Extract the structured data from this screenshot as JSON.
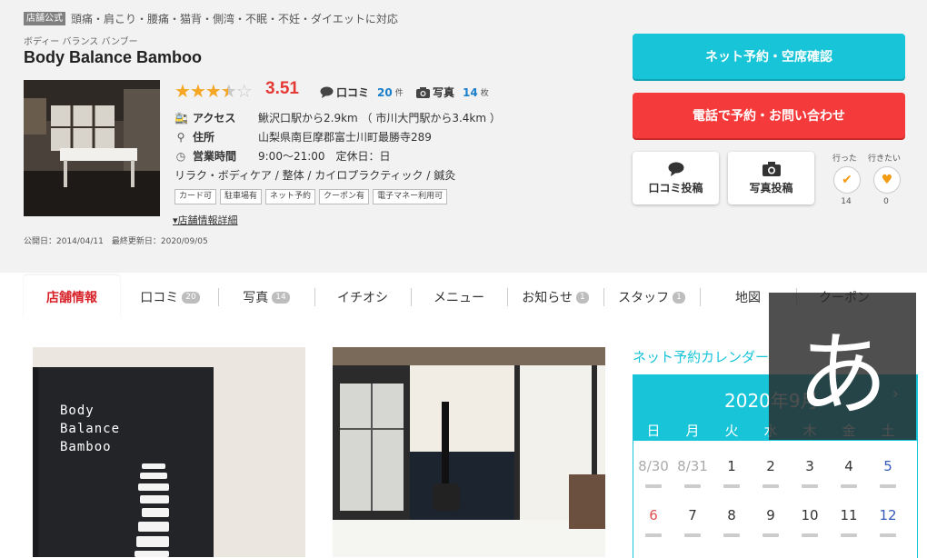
{
  "header": {
    "official_badge": "店舗公式",
    "tagline": "頭痛・肩こり・腰痛・猫背・側湾・不眠・不妊・ダイエットに対応",
    "name_kana": "ボディー バランス バンブー",
    "name": "Body Balance Bamboo",
    "rating": {
      "stars": 3.5,
      "value": "3.51"
    },
    "reviews": {
      "label": "口コミ",
      "count": "20",
      "unit": "件",
      "icon": "speech-bubble-icon"
    },
    "photos": {
      "label": "写真",
      "count": "14",
      "unit": "枚",
      "icon": "camera-icon"
    },
    "access": {
      "label": "アクセス",
      "value": "鰍沢口駅から2.9km （ 市川大門駅から3.4km ）",
      "icon": "train-icon"
    },
    "address": {
      "label": "住所",
      "value": "山梨県南巨摩郡富士川町最勝寺289",
      "icon": "pin-icon"
    },
    "hours": {
      "label": "営業時間",
      "value": "9:00～21:00　定休日：日",
      "icon": "clock-icon"
    },
    "categories": "リラク・ボディケア / 整体 / カイロプラクティック / 鍼灸",
    "features": [
      "カード可",
      "駐車場有",
      "ネット予約",
      "クーポン有",
      "電子マネー利用可"
    ],
    "details_link": "▾店舗情報詳細",
    "dates": "公開日：2014/04/11　最終更新日：2020/09/05"
  },
  "actions": {
    "net_reserve": "ネット予約・空席確認",
    "phone_reserve": "電話で予約・お問い合わせ",
    "post_review": "口コミ投稿",
    "post_photo": "写真投稿",
    "went": {
      "label": "行った",
      "count": "14"
    },
    "want": {
      "label": "行きたい",
      "count": "0"
    }
  },
  "tabs": [
    {
      "label": "店舗情報",
      "count": ""
    },
    {
      "label": "口コミ",
      "count": "20"
    },
    {
      "label": "写真",
      "count": "14"
    },
    {
      "label": "イチオシ",
      "count": ""
    },
    {
      "label": "メニュー",
      "count": ""
    },
    {
      "label": "お知らせ",
      "count": "1"
    },
    {
      "label": "スタッフ",
      "count": "1"
    },
    {
      "label": "地図",
      "count": ""
    },
    {
      "label": "クーポン",
      "count": ""
    }
  ],
  "card_text": [
    "Body",
    "Balance",
    "Bamboo"
  ],
  "calendar": {
    "title": "ネット予約カレンダー",
    "month": "2020年9月",
    "next": "›",
    "weekdays": [
      "日",
      "月",
      "火",
      "水",
      "木",
      "金",
      "土"
    ],
    "rows": [
      [
        "8/30",
        "8/31",
        "1",
        "2",
        "3",
        "4",
        "5"
      ],
      [
        "6",
        "7",
        "8",
        "9",
        "10",
        "11",
        "12"
      ]
    ]
  },
  "ime_indicator": "あ",
  "colors": {
    "accent": "#17c4d8",
    "red": "#f43a3a",
    "star": "#f5a623",
    "rating": "#e53935"
  }
}
